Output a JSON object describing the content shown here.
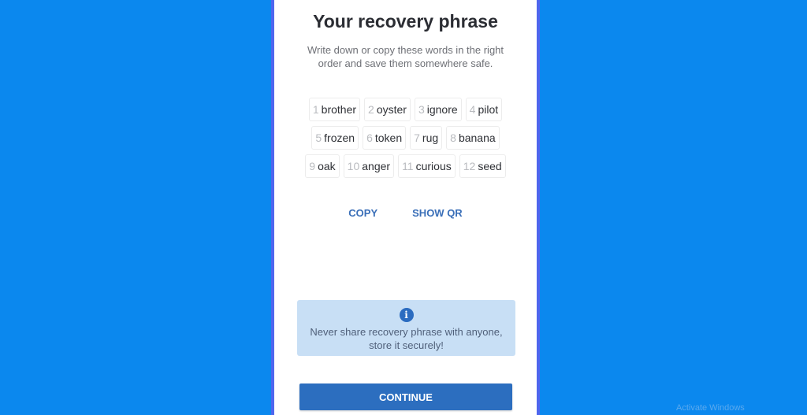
{
  "screen": {
    "title": "Your recovery phrase",
    "subtitle": "Write down or copy these words in the right order and save them somewhere safe.",
    "words": [
      {
        "num": "1",
        "word": "brother"
      },
      {
        "num": "2",
        "word": "oyster"
      },
      {
        "num": "3",
        "word": "ignore"
      },
      {
        "num": "4",
        "word": "pilot"
      },
      {
        "num": "5",
        "word": "frozen"
      },
      {
        "num": "6",
        "word": "token"
      },
      {
        "num": "7",
        "word": "rug"
      },
      {
        "num": "8",
        "word": "banana"
      },
      {
        "num": "9",
        "word": "oak"
      },
      {
        "num": "10",
        "word": "anger"
      },
      {
        "num": "11",
        "word": "curious"
      },
      {
        "num": "12",
        "word": "seed"
      }
    ],
    "actions": {
      "copy_label": "COPY",
      "show_qr_label": "SHOW QR"
    },
    "notice": {
      "icon": "info-icon",
      "icon_glyph": "i",
      "text_line1": "Never share recovery phrase with anyone,",
      "text_line2": "store it securely!"
    },
    "continue_label": "CONTINUE"
  },
  "os": {
    "watermark": "Activate Windows"
  },
  "colors": {
    "background": "#0b88ee",
    "accent": "#2c6ebf",
    "notice_bg": "#c8dff5"
  }
}
